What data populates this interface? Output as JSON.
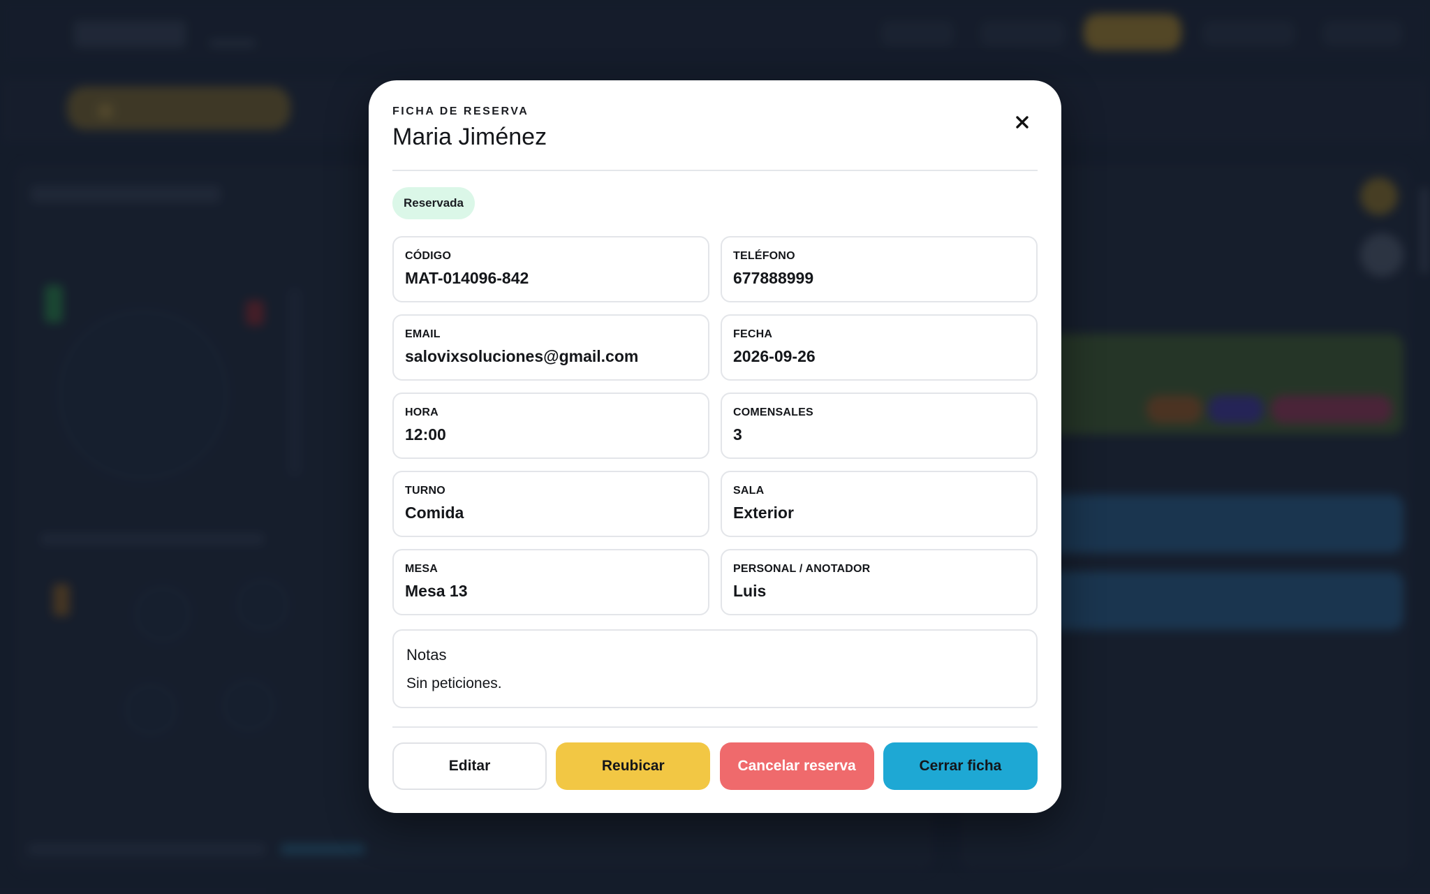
{
  "modal": {
    "eyebrow": "FICHA DE RESERVA",
    "guest_name": "Maria Jiménez",
    "close_icon": "close-icon",
    "status": "Reservada",
    "status_color": "#dbf7e8",
    "fields": [
      {
        "label": "CÓDIGO",
        "value": "MAT-014096-842"
      },
      {
        "label": "TELÉFONO",
        "value": "677888999"
      },
      {
        "label": "EMAIL",
        "value": "salovixsoluciones@gmail.com"
      },
      {
        "label": "FECHA",
        "value": "2026-09-26"
      },
      {
        "label": "HORA",
        "value": "12:00"
      },
      {
        "label": "COMENSALES",
        "value": "3"
      },
      {
        "label": "TURNO",
        "value": "Comida"
      },
      {
        "label": "SALA",
        "value": "Exterior"
      },
      {
        "label": "MESA",
        "value": "Mesa 13"
      },
      {
        "label": "PERSONAL / ANOTADOR",
        "value": "Luis"
      }
    ],
    "notes": {
      "title": "Notas",
      "text": "Sin peticiones."
    },
    "actions": {
      "edit": "Editar",
      "relocate": "Reubicar",
      "cancel": "Cancelar reserva",
      "close": "Cerrar ficha"
    },
    "colors": {
      "relocate": "#f2c744",
      "cancel": "#ef6a6c",
      "close": "#1ea8d4"
    }
  }
}
